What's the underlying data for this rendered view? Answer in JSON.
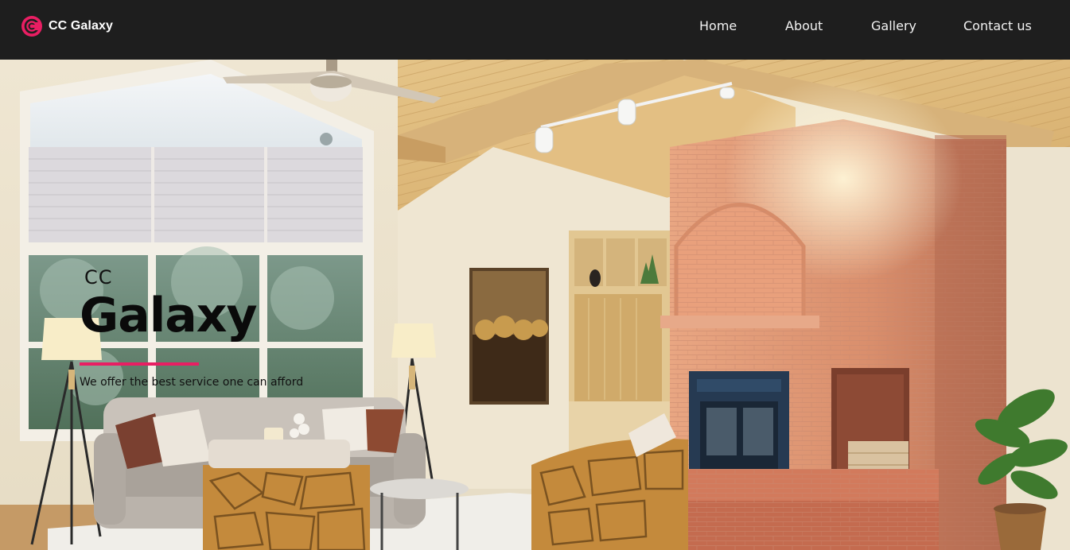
{
  "brand": {
    "name": "CC Galaxy",
    "accent_color": "#e91e63",
    "logo_icon": "cc-logo-icon"
  },
  "nav": {
    "items": [
      {
        "label": "Home"
      },
      {
        "label": "About"
      },
      {
        "label": "Gallery"
      },
      {
        "label": "Contact us"
      }
    ]
  },
  "hero": {
    "small_text": "CC",
    "title": "Galaxy",
    "tagline": "We offer the best service one can afford",
    "background": "living-room-with-brick-fireplace-photo"
  },
  "colors": {
    "navbar_bg": "#1e1e1e",
    "nav_text": "#f2f2f2",
    "accent": "#e91e63"
  }
}
